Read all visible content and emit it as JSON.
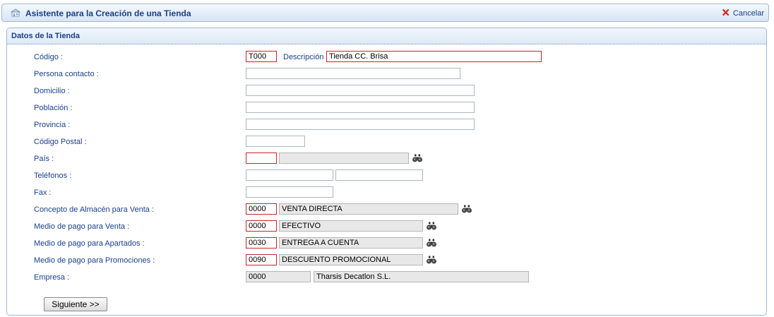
{
  "header": {
    "title": "Asistente para la Creación de una Tienda",
    "cancel_label": "Cancelar"
  },
  "section": {
    "title": "Datos de la Tienda"
  },
  "fields": {
    "codigo": {
      "label": "Código :",
      "value": "T000"
    },
    "descripcion": {
      "label": "Descripción :",
      "value": "Tienda CC. Brisa"
    },
    "persona_contacto": {
      "label": "Persona contacto :",
      "value": ""
    },
    "domicilio": {
      "label": "Domicilio :",
      "value": ""
    },
    "poblacion": {
      "label": "Población :",
      "value": ""
    },
    "provincia": {
      "label": "Provincia :",
      "value": ""
    },
    "codigo_postal": {
      "label": "Código Postal :",
      "value": ""
    },
    "pais": {
      "label": "País :",
      "code": "",
      "name": ""
    },
    "telefonos": {
      "label": "Teléfonos :",
      "value1": "",
      "value2": ""
    },
    "fax": {
      "label": "Fax :",
      "value": ""
    },
    "concepto_almacen": {
      "label": "Concepto de Almacén para Venta :",
      "code": "0000",
      "name": "VENTA DIRECTA"
    },
    "medio_pago_venta": {
      "label": "Medio de pago para Venta :",
      "code": "0000",
      "name": "EFECTIVO"
    },
    "medio_pago_apartados": {
      "label": "Medio de pago para Apartados :",
      "code": "0030",
      "name": "ENTREGA A CUENTA"
    },
    "medio_pago_promociones": {
      "label": "Medio de pago para Promociones :",
      "code": "0090",
      "name": "DESCUENTO PROMOCIONAL"
    },
    "empresa": {
      "label": "Empresa :",
      "code": "0000",
      "name": "Tharsis Decatlon S.L."
    }
  },
  "buttons": {
    "next_label": "Siguiente >>"
  },
  "icons": {
    "title": "store-icon",
    "cancel": "close-icon",
    "lookup": "binoculars-icon"
  },
  "colors": {
    "label_text": "#1a3f8f",
    "required_border": "#c0282b",
    "cancel_x": "#d21b12",
    "readonly_bg": "#e8e8e8"
  }
}
